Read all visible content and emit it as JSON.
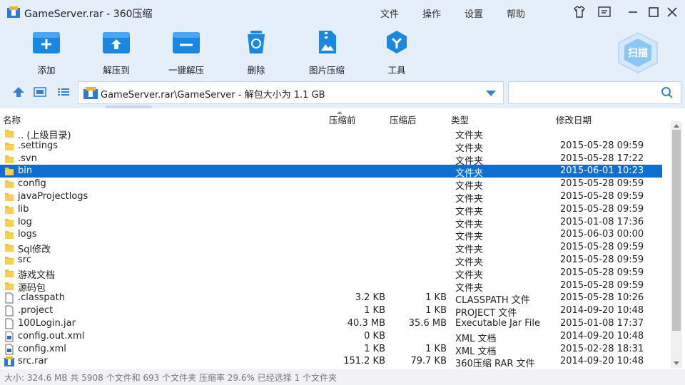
{
  "window": {
    "title": "GameServer.rar - 360压缩",
    "menu": [
      "文件",
      "操作",
      "设置",
      "帮助"
    ],
    "controls": [
      "skin-icon",
      "feedback-icon",
      "minimize-icon",
      "maximize-icon",
      "close-icon"
    ]
  },
  "toolbar": {
    "buttons": [
      {
        "label": "添加",
        "icon": "add-icon"
      },
      {
        "label": "解压到",
        "icon": "extract-to-icon"
      },
      {
        "label": "一键解压",
        "icon": "one-click-extract-icon"
      },
      {
        "label": "删除",
        "icon": "delete-icon"
      },
      {
        "label": "图片压缩",
        "icon": "image-compress-icon"
      },
      {
        "label": "工具",
        "icon": "tools-icon"
      }
    ],
    "scan_label": "扫描"
  },
  "address": {
    "path": "GameServer.rar\\GameServer - 解包大小为 1.1 GB",
    "search_value": ""
  },
  "columns": [
    "名称",
    "压缩前",
    "压缩后",
    "类型",
    "修改日期"
  ],
  "files": [
    {
      "name": ".. (上级目录)",
      "packed": "",
      "unpacked": "",
      "type": "文件夹",
      "date": "",
      "icon": "folder"
    },
    {
      "name": ".settings",
      "packed": "",
      "unpacked": "",
      "type": "文件夹",
      "date": "2015-05-28 09:59",
      "icon": "folder"
    },
    {
      "name": ".svn",
      "packed": "",
      "unpacked": "",
      "type": "文件夹",
      "date": "2015-05-28 17:22",
      "icon": "folder"
    },
    {
      "name": "bin",
      "packed": "",
      "unpacked": "",
      "type": "文件夹",
      "date": "2015-06-01 10:23",
      "icon": "folder",
      "selected": true
    },
    {
      "name": "config",
      "packed": "",
      "unpacked": "",
      "type": "文件夹",
      "date": "2015-05-28 09:59",
      "icon": "folder"
    },
    {
      "name": "javaProjectlogs",
      "packed": "",
      "unpacked": "",
      "type": "文件夹",
      "date": "2015-05-28 09:59",
      "icon": "folder"
    },
    {
      "name": "lib",
      "packed": "",
      "unpacked": "",
      "type": "文件夹",
      "date": "2015-05-28 09:59",
      "icon": "folder"
    },
    {
      "name": "log",
      "packed": "",
      "unpacked": "",
      "type": "文件夹",
      "date": "2015-01-08 17:36",
      "icon": "folder"
    },
    {
      "name": "logs",
      "packed": "",
      "unpacked": "",
      "type": "文件夹",
      "date": "2015-06-03 00:00",
      "icon": "folder"
    },
    {
      "name": "Sql修改",
      "packed": "",
      "unpacked": "",
      "type": "文件夹",
      "date": "2015-05-28 09:59",
      "icon": "folder"
    },
    {
      "name": "src",
      "packed": "",
      "unpacked": "",
      "type": "文件夹",
      "date": "2015-05-28 09:59",
      "icon": "folder"
    },
    {
      "name": "游戏文档",
      "packed": "",
      "unpacked": "",
      "type": "文件夹",
      "date": "2015-05-28 09:59",
      "icon": "folder"
    },
    {
      "name": "源码包",
      "packed": "",
      "unpacked": "",
      "type": "文件夹",
      "date": "2015-05-28 09:59",
      "icon": "folder"
    },
    {
      "name": ".classpath",
      "packed": "3.2 KB",
      "unpacked": "1 KB",
      "type": "CLASSPATH 文件",
      "date": "2015-05-28 10:26",
      "icon": "file"
    },
    {
      "name": ".project",
      "packed": "1 KB",
      "unpacked": "1 KB",
      "type": "PROJECT 文件",
      "date": "2014-09-20 10:48",
      "icon": "file"
    },
    {
      "name": "100Login.jar",
      "packed": "40.3 MB",
      "unpacked": "35.6 MB",
      "type": "Executable Jar File",
      "date": "2015-01-08 17:37",
      "icon": "file"
    },
    {
      "name": "config.out.xml",
      "packed": "0 KB",
      "unpacked": "",
      "type": "XML 文档",
      "date": "2014-09-20 10:48",
      "icon": "xml"
    },
    {
      "name": "config.xml",
      "packed": "1 KB",
      "unpacked": "1 KB",
      "type": "XML 文档",
      "date": "2015-02-28 18:31",
      "icon": "xml"
    },
    {
      "name": "src.rar",
      "packed": "151.2 KB",
      "unpacked": "79.7 KB",
      "type": "360压缩 RAR 文件",
      "date": "2014-09-20 10:48",
      "icon": "rar"
    }
  ],
  "status": "大小: 324.6 MB 共 5908 个文件和 693 个文件夹 压缩率 29.6% 已经选择 1 个文件夹",
  "colors": {
    "accent": "#1a88e0",
    "selected": "#0e6fd0",
    "toolbar_bg": "#e4effa",
    "folder": "#f4c430"
  }
}
